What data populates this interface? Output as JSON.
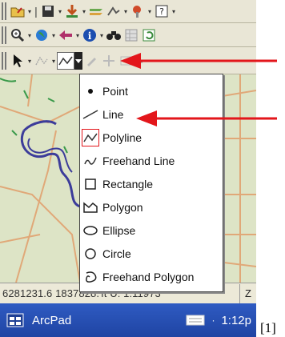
{
  "menu": {
    "items": [
      {
        "label": "Point",
        "icon": "point-icon"
      },
      {
        "label": "Line",
        "icon": "line-icon"
      },
      {
        "label": "Polyline",
        "icon": "polyline-icon",
        "selected": true
      },
      {
        "label": "Freehand Line",
        "icon": "freehand-line-icon"
      },
      {
        "label": "Rectangle",
        "icon": "rectangle-icon"
      },
      {
        "label": "Polygon",
        "icon": "polygon-icon"
      },
      {
        "label": "Ellipse",
        "icon": "ellipse-icon"
      },
      {
        "label": "Circle",
        "icon": "circle-icon"
      },
      {
        "label": "Freehand Polygon",
        "icon": "freehand-polygon-icon"
      }
    ]
  },
  "status": {
    "coordinates": "6281231.6 1837828.",
    "scale": "ft U: 1:11973",
    "right_cell": "Z"
  },
  "taskbar": {
    "app_name": "ArcPad",
    "time": "1:12p"
  },
  "footnote": "[1]",
  "colors": {
    "annotation_arrow": "#e3161b",
    "road_lines": "#e0a878",
    "polyline_feature": "#3c3c9a",
    "taskbar": "#2a52b8"
  }
}
